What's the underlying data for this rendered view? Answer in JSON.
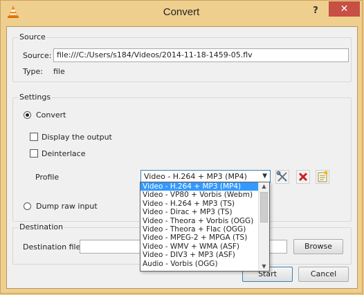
{
  "window": {
    "title": "Convert",
    "help_label": "?",
    "close_label": "✕"
  },
  "source": {
    "group_title": "Source",
    "source_label": "Source:",
    "source_value": "file:///C:/Users/s184/Videos/2014-11-18-1459-05.flv",
    "type_label": "Type:",
    "type_value": "file"
  },
  "settings": {
    "group_title": "Settings",
    "convert_label": "Convert",
    "convert_checked": true,
    "display_output_label": "Display the output",
    "deinterlace_label": "Deinterlace",
    "profile_label": "Profile",
    "profile_selected": "Video - H.264 + MP3 (MP4)",
    "dump_raw_label": "Dump raw input",
    "profile_options": [
      "Video - H.264 + MP3 (MP4)",
      "Video - VP80 + Vorbis (Webm)",
      "Video - H.264 + MP3 (TS)",
      "Video - Dirac + MP3 (TS)",
      "Video - Theora + Vorbis (OGG)",
      "Video - Theora + Flac (OGG)",
      "Video - MPEG-2 + MPGA (TS)",
      "Video - WMV + WMA (ASF)",
      "Video - DIV3 + MP3 (ASF)",
      "Audio - Vorbis (OGG)"
    ]
  },
  "destination": {
    "group_title": "Destination",
    "file_label": "Destination file:",
    "file_value": "",
    "browse_label": "Browse"
  },
  "footer": {
    "start_label": "Start",
    "cancel_label": "Cancel"
  },
  "icons": {
    "app": "vlc-cone-icon",
    "edit_profile": "tools-icon",
    "delete_profile": "red-x-icon",
    "new_profile": "new-document-icon"
  },
  "colors": {
    "title_bar": "#efcf8e",
    "close_button": "#c74f43",
    "selection": "#3399ff"
  }
}
